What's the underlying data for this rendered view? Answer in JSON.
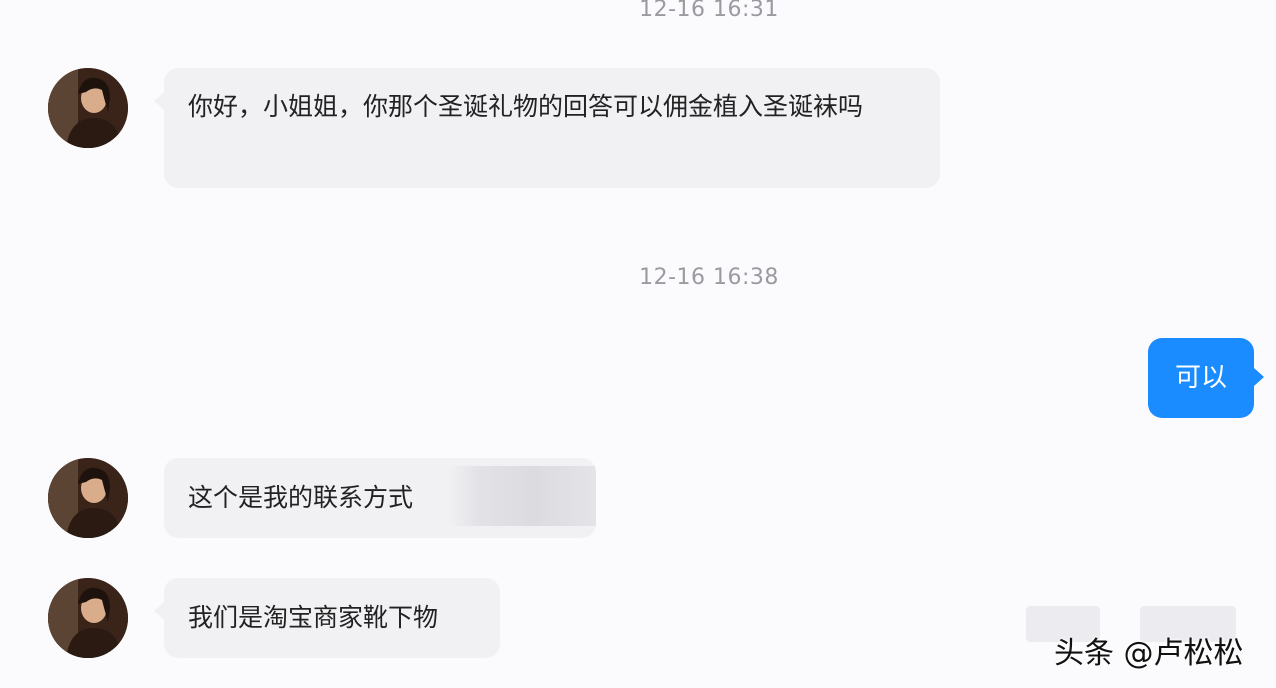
{
  "timestamps": [
    "12-16 16:31",
    "12-16 16:38"
  ],
  "messages": {
    "incoming_1": "你好，小姐姐，你那个圣诞礼物的回答可以佣金植入圣诞袜吗",
    "outgoing_1": "可以",
    "incoming_2": "这个是我的联系方式",
    "incoming_3": "我们是淘宝商家靴下物"
  },
  "watermark": "头条 @卢松松",
  "colors": {
    "background": "#fbfbfd",
    "incoming_bubble": "#f1f1f4",
    "outgoing_bubble": "#1a8cff",
    "timestamp_text": "#9a9aa2"
  }
}
